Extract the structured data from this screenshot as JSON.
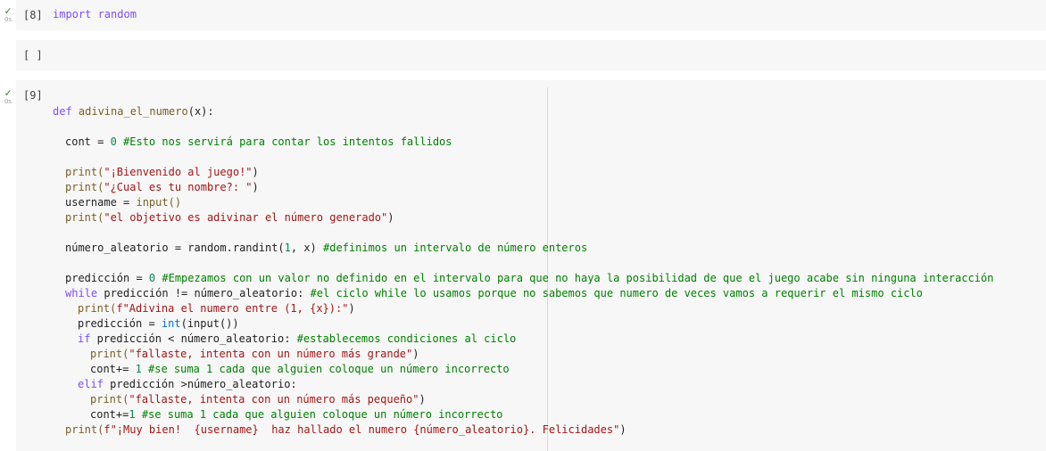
{
  "cells": [
    {
      "exec_count": "[8]",
      "status_time": "0s",
      "code": "import random"
    },
    {
      "exec_count": "[ ]"
    },
    {
      "exec_count": "[9]",
      "status_time": "0s"
    }
  ],
  "code9": {
    "l1_def": "def ",
    "l1_name": "adivina_el_numero",
    "l1_rest": "(x):",
    "l2_a": "cont = ",
    "l2_num": "0",
    "l2_com": " #Esto nos servirá para contar los intentos fallidos",
    "l3_fn": "print(",
    "l3_str": "\"¡Bienvenido al juego!\"",
    "l3_end": ")",
    "l4_fn": "print(",
    "l4_str": "\"¿Cual es tu nombre?: \"",
    "l4_end": ")",
    "l5_a": "username = ",
    "l5_fn": "input()",
    "l6_fn": "print(",
    "l6_str": "\"el objetivo es adivinar el número generado\"",
    "l6_end": ")",
    "l7_a": "número_aleatorio = random.randint(",
    "l7_num": "1",
    "l7_b": ", x) ",
    "l7_com": "#definimos un intervalo de número enteros",
    "l8_a": "predicción = ",
    "l8_num": "0",
    "l8_com": " #Empezamos con un valor no definido en el intervalo para que no haya la posibilidad de que el juego acabe sin ninguna interacción",
    "l9_kw": "while",
    "l9_a": " predicción != número_aleatorio: ",
    "l9_com": "#el ciclo while lo usamos porque no sabemos que numero de veces vamos a requerir el mismo ciclo",
    "l10_fn": "print(",
    "l10_str": "f\"Adivina el numero entre (1, {x}):\"",
    "l10_end": ")",
    "l11_a": "predicción = ",
    "l11_bi": "int",
    "l11_b": "(input())",
    "l12_kw": "if",
    "l12_a": " predicción < número_aleatorio: ",
    "l12_com": "#establecemos condiciones al ciclo",
    "l13_fn": "print(",
    "l13_str": "\"fallaste, intenta con un número más grande\"",
    "l13_end": ")",
    "l14_a": "cont+= ",
    "l14_num": "1",
    "l14_com": " #se suma 1 cada que alguien coloque un número incorrecto",
    "l15_kw": "elif",
    "l15_a": " predicción >número_aleatorio:",
    "l16_fn": "print(",
    "l16_str": "\"fallaste, intenta con un número más pequeño\"",
    "l16_end": ")",
    "l17_a": "cont+=",
    "l17_num": "1",
    "l17_com": " #se suma 1 cada que alguien coloque un número incorrecto",
    "l18_fn": "print(",
    "l18_str": "f\"¡Muy bien!  {username}  haz hallado el numero {número_aleatorio}. Felicidades\"",
    "l18_end": ")"
  }
}
